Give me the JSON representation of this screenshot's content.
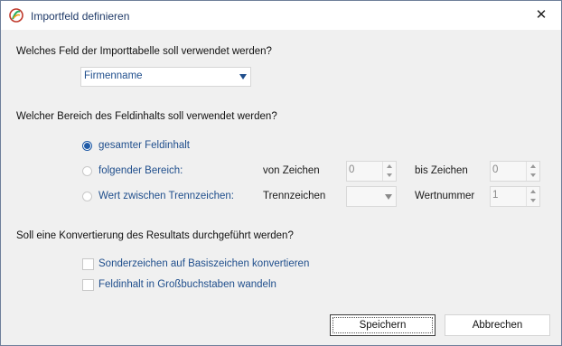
{
  "window": {
    "title": "Importfeld definieren",
    "close_glyph": "✕"
  },
  "q1": {
    "label": "Welches Feld der Importtabelle soll verwendet werden?",
    "field_value": "Firmenname"
  },
  "q2": {
    "label": "Welcher Bereich des Feldinhalts soll verwendet werden?",
    "options": [
      {
        "label": "gesamter Feldinhalt",
        "selected": true
      },
      {
        "label": "folgender Bereich:",
        "selected": false
      },
      {
        "label": "Wert zwischen Trennzeichen:",
        "selected": false
      }
    ],
    "von_label": "von Zeichen",
    "von_value": "0",
    "bis_label": "bis Zeichen",
    "bis_value": "0",
    "trenn_label": "Trennzeichen",
    "trenn_value": "",
    "wert_label": "Wertnummer",
    "wert_value": "1"
  },
  "q3": {
    "label": "Soll eine Konvertierung des Resultats durchgeführt werden?",
    "checks": [
      {
        "label": "Sonderzeichen auf Basiszeichen konvertieren",
        "checked": false
      },
      {
        "label": "Feldinhalt in Großbuchstaben wandeln",
        "checked": false
      }
    ]
  },
  "buttons": {
    "save": "Speichern",
    "cancel": "Abbrechen"
  },
  "colors": {
    "accent": "#1f5aa6",
    "label_blue": "#1f4e8c"
  }
}
